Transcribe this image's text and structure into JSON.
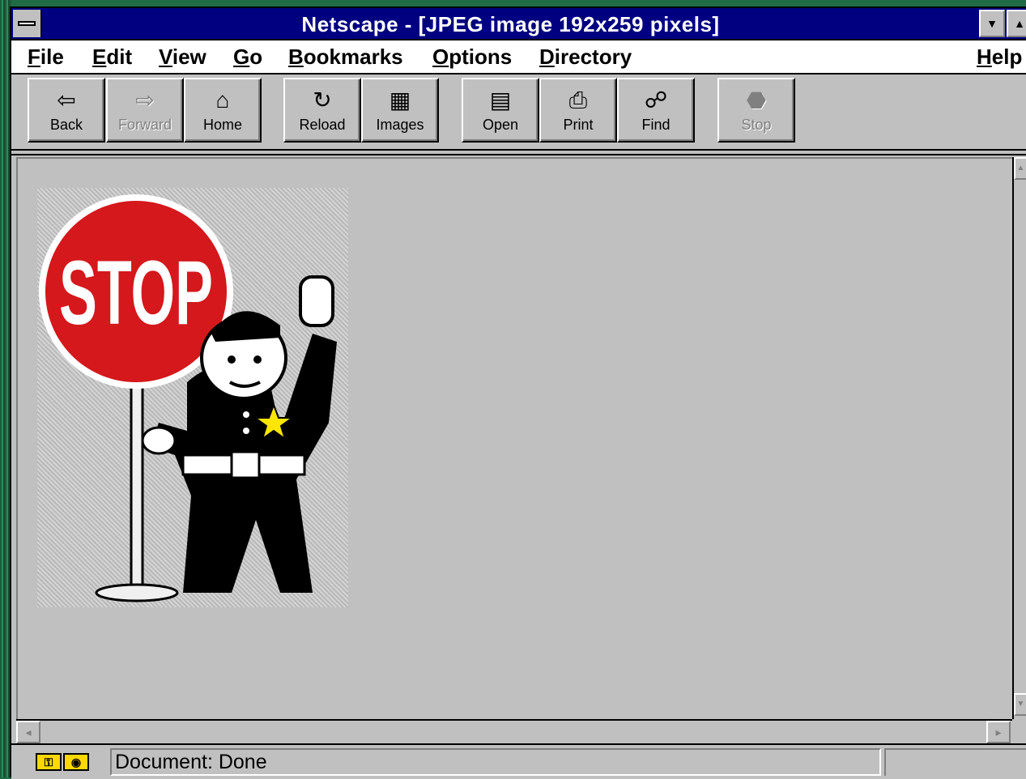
{
  "window": {
    "title": "Netscape - [JPEG image 192x259 pixels]"
  },
  "menu": [
    {
      "mnemonic": "F",
      "rest": "ile"
    },
    {
      "mnemonic": "E",
      "rest": "dit"
    },
    {
      "mnemonic": "V",
      "rest": "iew"
    },
    {
      "mnemonic": "G",
      "rest": "o"
    },
    {
      "mnemonic": "B",
      "rest": "ookmarks"
    },
    {
      "mnemonic": "O",
      "rest": "ptions"
    },
    {
      "mnemonic": "D",
      "rest": "irectory"
    },
    {
      "mnemonic": "H",
      "rest": "elp"
    }
  ],
  "toolbar": {
    "back": {
      "label": "Back",
      "icon": "back-arrow-icon"
    },
    "forward": {
      "label": "Forward",
      "icon": "forward-arrow-icon",
      "disabled": true
    },
    "home": {
      "label": "Home",
      "icon": "home-icon"
    },
    "reload": {
      "label": "Reload",
      "icon": "reload-icon"
    },
    "images": {
      "label": "Images",
      "icon": "images-icon"
    },
    "open": {
      "label": "Open",
      "icon": "open-icon"
    },
    "print": {
      "label": "Print",
      "icon": "printer-icon"
    },
    "find": {
      "label": "Find",
      "icon": "binoculars-icon"
    },
    "stop": {
      "label": "Stop",
      "icon": "stop-icon",
      "disabled": true
    }
  },
  "content": {
    "image": {
      "sign_text": "STOP",
      "colors": {
        "sign": "#d4181c",
        "star": "#ffe600",
        "uniform": "#000000"
      }
    }
  },
  "status": {
    "text": "Document: Done"
  },
  "colors": {
    "titlebar": "#000080",
    "chrome": "#c0c0c0",
    "desktop": "#1f6b45"
  }
}
